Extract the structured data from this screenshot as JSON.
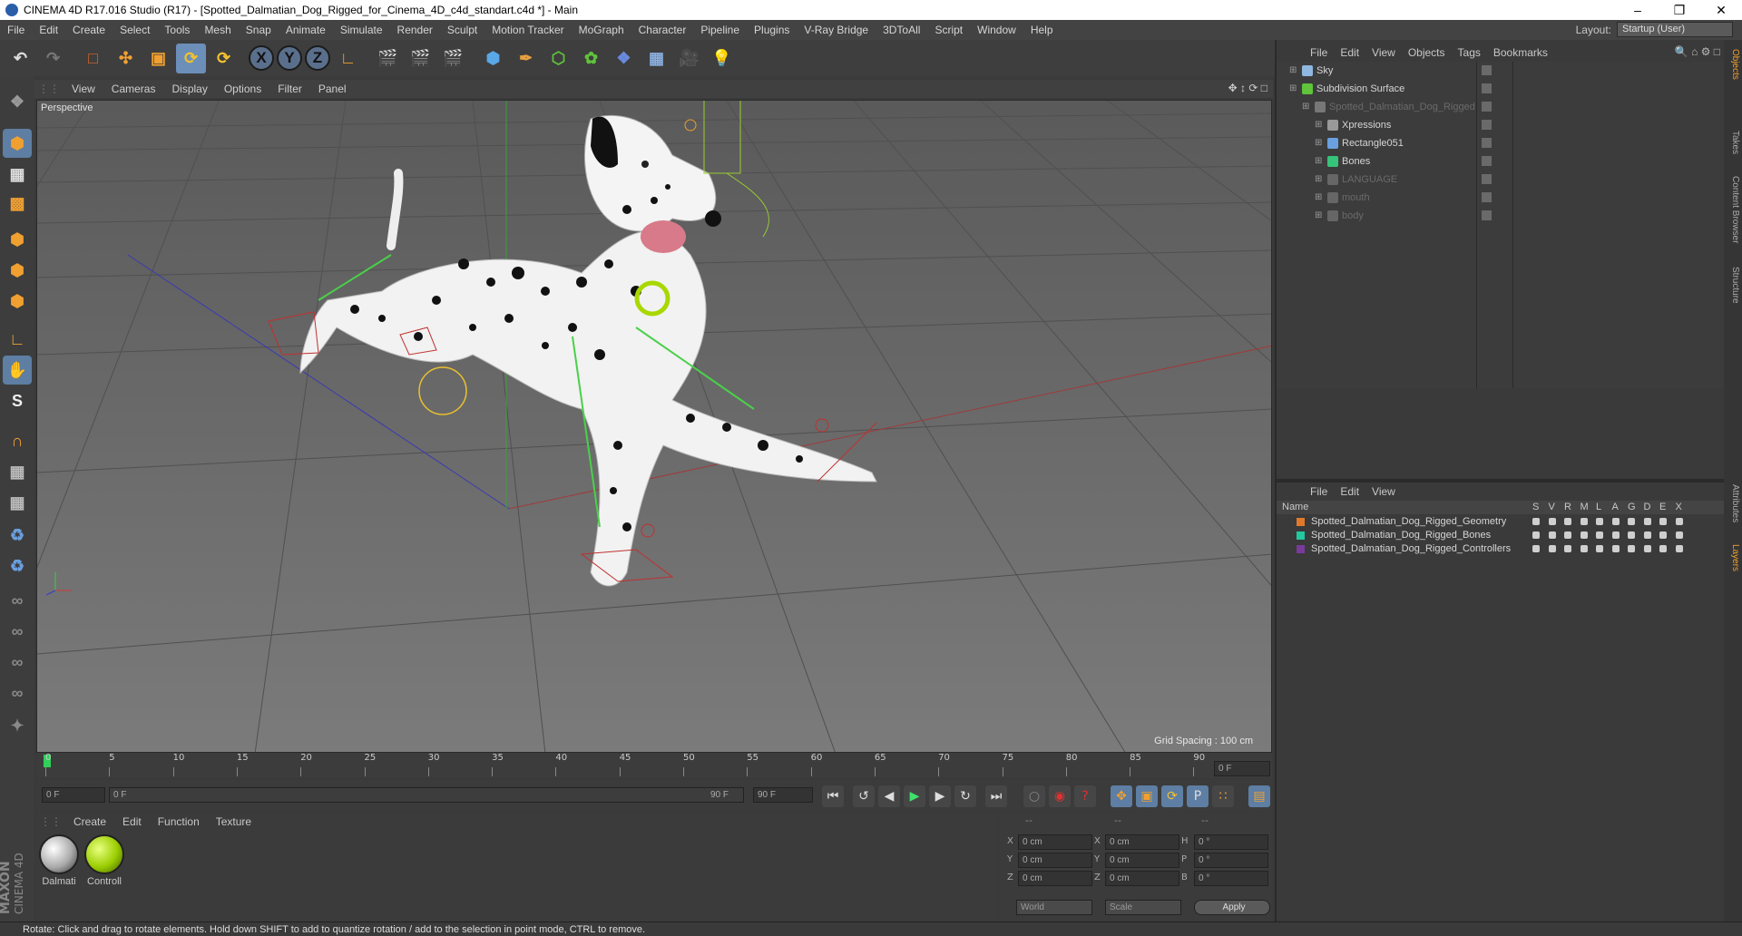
{
  "window": {
    "title": "CINEMA 4D R17.016 Studio (R17) - [Spotted_Dalmatian_Dog_Rigged_for_Cinema_4D_c4d_standart.c4d *] - Main"
  },
  "menu": [
    "File",
    "Edit",
    "Create",
    "Select",
    "Tools",
    "Mesh",
    "Snap",
    "Animate",
    "Simulate",
    "Render",
    "Sculpt",
    "Motion Tracker",
    "MoGraph",
    "Character",
    "Pipeline",
    "Plugins",
    "V-Ray Bridge",
    "3DToAll",
    "Script",
    "Window",
    "Help"
  ],
  "layout": {
    "label": "Layout:",
    "value": "Startup (User)"
  },
  "toolbar": {
    "x": "X",
    "y": "Y",
    "z": "Z"
  },
  "viewport": {
    "menu": [
      "View",
      "Cameras",
      "Display",
      "Options",
      "Filter",
      "Panel"
    ],
    "label": "Perspective",
    "grid_spacing": "Grid Spacing : 100 cm"
  },
  "timeline": {
    "ticks": [
      "0",
      "5",
      "10",
      "15",
      "20",
      "25",
      "30",
      "35",
      "40",
      "45",
      "50",
      "55",
      "60",
      "65",
      "70",
      "75",
      "80",
      "85",
      "90"
    ],
    "current_frame": "0 F",
    "start": "0 F",
    "range_start": "0 F",
    "range_end": "90 F",
    "end": "90 F"
  },
  "materials": {
    "menu": [
      "Create",
      "Edit",
      "Function",
      "Texture"
    ],
    "items": [
      {
        "name": "Dalmati",
        "color": "#bdbdbd"
      },
      {
        "name": "Controll",
        "color": "#9acd00"
      }
    ]
  },
  "coords": {
    "headers": [
      "--",
      "--",
      "--"
    ],
    "rows": [
      {
        "a": "X",
        "av": "0 cm",
        "b": "X",
        "bv": "0 cm",
        "c": "H",
        "cv": "0 °"
      },
      {
        "a": "Y",
        "av": "0 cm",
        "b": "Y",
        "bv": "0 cm",
        "c": "P",
        "cv": "0 °"
      },
      {
        "a": "Z",
        "av": "0 cm",
        "b": "Z",
        "bv": "0 cm",
        "c": "B",
        "cv": "0 °"
      }
    ],
    "space": "World",
    "mode": "Scale",
    "apply": "Apply"
  },
  "objects": {
    "menu": [
      "File",
      "Edit",
      "View",
      "Objects",
      "Tags",
      "Bookmarks"
    ],
    "rows": [
      {
        "name": "Sky",
        "indent": 0,
        "icon": "#8fb7e0",
        "dim": false
      },
      {
        "name": "Subdivision Surface",
        "indent": 0,
        "icon": "#5fc33b",
        "dim": false
      },
      {
        "name": "Spotted_Dalmatian_Dog_Rigged",
        "indent": 1,
        "icon": "#777",
        "dim": true
      },
      {
        "name": "Xpressions",
        "indent": 2,
        "icon": "#999",
        "dim": false
      },
      {
        "name": "Rectangle051",
        "indent": 2,
        "icon": "#6aa0e0",
        "dim": false
      },
      {
        "name": "Bones",
        "indent": 2,
        "icon": "#36c47a",
        "dim": false
      },
      {
        "name": "LANGUAGE",
        "indent": 2,
        "icon": "#666",
        "dim": true
      },
      {
        "name": "mouth",
        "indent": 2,
        "icon": "#666",
        "dim": true
      },
      {
        "name": "body",
        "indent": 2,
        "icon": "#666",
        "dim": true
      }
    ]
  },
  "layers": {
    "menu": [
      "File",
      "Edit",
      "View"
    ],
    "header": {
      "name": "Name",
      "cols": [
        "S",
        "V",
        "R",
        "M",
        "L",
        "A",
        "G",
        "D",
        "E",
        "X"
      ]
    },
    "rows": [
      {
        "name": "Spotted_Dalmatian_Dog_Rigged_Geometry",
        "color": "#e07a2a"
      },
      {
        "name": "Spotted_Dalmatian_Dog_Rigged_Bones",
        "color": "#22c9a0"
      },
      {
        "name": "Spotted_Dalmatian_Dog_Rigged_Controllers",
        "color": "#7a3a9a"
      }
    ]
  },
  "side_tabs": [
    "Objects",
    "Takes",
    "Content Browser",
    "Structure",
    "Attributes",
    "Layers"
  ],
  "status": "Rotate: Click and drag to rotate elements. Hold down SHIFT to add to quantize rotation / add to the selection in point mode, CTRL to remove.",
  "brand": {
    "maxon": "MAXON",
    "product": "CINEMA 4D"
  }
}
